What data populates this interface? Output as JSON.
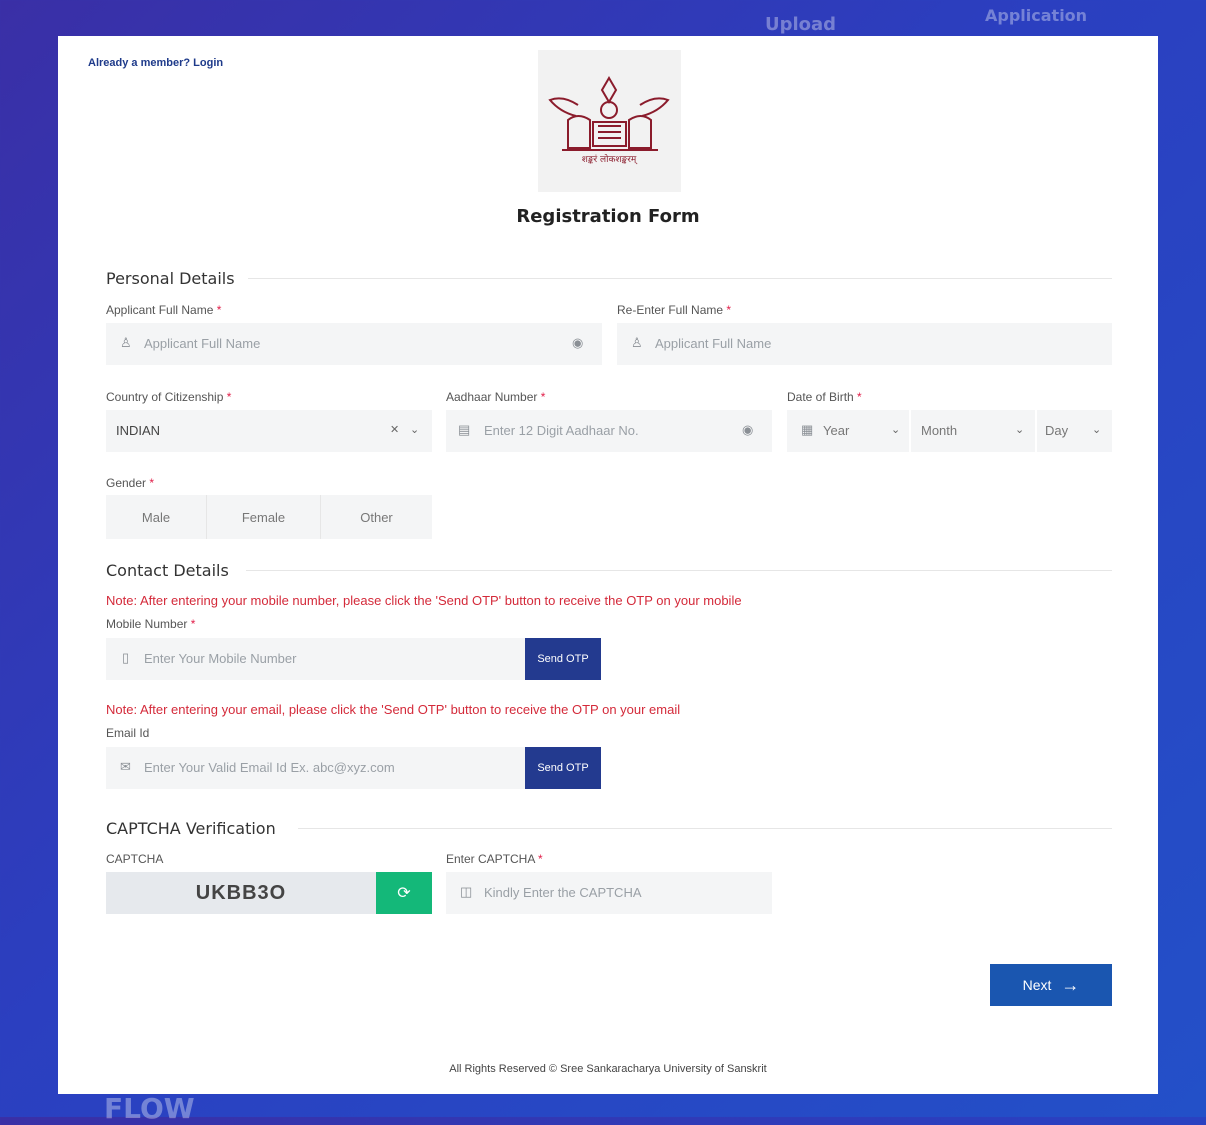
{
  "background": {
    "words": [
      "Upload",
      "Application",
      "FLOW"
    ]
  },
  "header": {
    "login_link": "Already a member? Login",
    "title": "Registration Form",
    "logo_caption": "शङ्करं लोकशङ्करम्"
  },
  "sections": {
    "personal": "Personal Details",
    "contact": "Contact Details",
    "captcha": "CAPTCHA Verification"
  },
  "personal": {
    "full_name": {
      "label": "Applicant Full Name",
      "placeholder": "Applicant Full Name"
    },
    "reenter_name": {
      "label": "Re-Enter Full Name",
      "placeholder": "Applicant Full Name"
    },
    "country": {
      "label": "Country of Citizenship",
      "value": "INDIAN"
    },
    "aadhaar": {
      "label": "Aadhaar Number",
      "placeholder": "Enter 12 Digit Aadhaar No."
    },
    "dob": {
      "label": "Date of Birth",
      "year": "Year",
      "month": "Month",
      "day": "Day"
    },
    "gender": {
      "label": "Gender",
      "options": [
        "Male",
        "Female",
        "Other"
      ]
    }
  },
  "contact": {
    "mobile_note": "Note: After entering your mobile number, please click the 'Send OTP' button to receive the OTP on your mobile",
    "mobile": {
      "label": "Mobile Number",
      "placeholder": "Enter Your Mobile Number",
      "button": "Send OTP"
    },
    "email_note": "Note: After entering your email, please click the 'Send OTP' button to receive the OTP on your email",
    "email": {
      "label": "Email Id",
      "placeholder": "Enter Your Valid Email Id Ex. abc@xyz.com",
      "button": "Send OTP"
    }
  },
  "captcha": {
    "label": "CAPTCHA",
    "code": "UKBB3O",
    "input_label": "Enter CAPTCHA",
    "placeholder": "Kindly Enter the CAPTCHA"
  },
  "actions": {
    "next": "Next"
  },
  "footer": {
    "text": "All Rights Reserved © Sree Sankaracharya University of Sanskrit"
  },
  "colors": {
    "primary": "#233a8f",
    "success": "#14b879",
    "note": "#d42a3a",
    "next": "#1a56b0"
  }
}
